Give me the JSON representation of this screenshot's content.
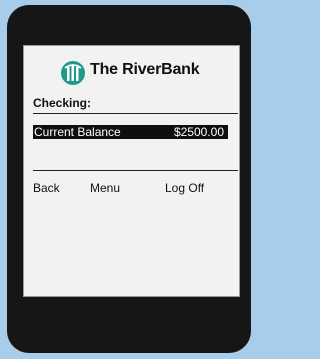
{
  "bank": {
    "name": "The RiverBank",
    "logo_icon": "riverbank-logo-icon",
    "logo_color": "#1f9a8a"
  },
  "account": {
    "section_title": "Checking:",
    "balance_label": "Current Balance",
    "balance_value": "$2500.00"
  },
  "nav": {
    "back": "Back",
    "menu": "Menu",
    "logoff": "Log Off"
  },
  "colors": {
    "background": "#a8cdea",
    "device": "#161616",
    "screen": "#f2f2f2",
    "highlight": "#0f0f0f"
  }
}
